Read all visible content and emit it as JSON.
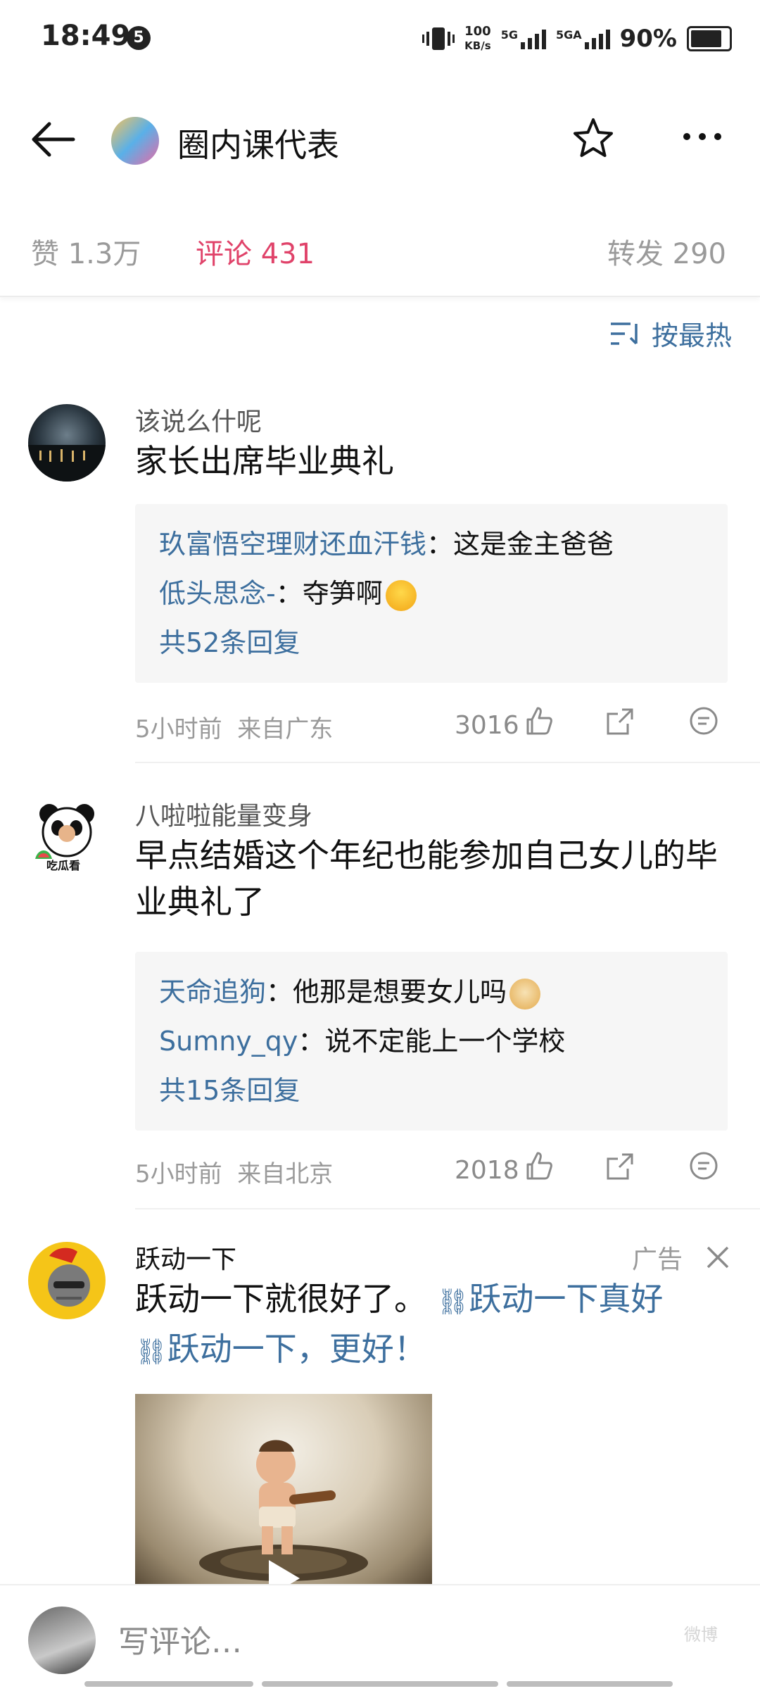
{
  "status_bar": {
    "time": "18:49",
    "notification_count": "5",
    "speed_top": "100",
    "speed_unit": "KB/s",
    "net1": "5G",
    "net2": "5GA",
    "battery": "90%",
    "battery_level": 0.9
  },
  "header": {
    "title": "圈内课代表",
    "icons": [
      "back-arrow-icon",
      "star-icon",
      "more-icon"
    ]
  },
  "tabs": [
    {
      "label": "赞 1.3万",
      "active": false
    },
    {
      "label": "评论 431",
      "active": true
    },
    {
      "label": "转发 290",
      "active": false
    }
  ],
  "sort": {
    "label": "按最热"
  },
  "comments": [
    {
      "user": "该说么什呢",
      "text": "家长出席毕业典礼",
      "replies": [
        {
          "name": "玖富悟空理财还血汗钱",
          "text": "：这是金主爸爸"
        },
        {
          "name": "低头思念-",
          "text": "：夺笋啊"
        }
      ],
      "total": "共52条回复",
      "time": "5小时前",
      "location": "来自广东",
      "likes": "3016"
    },
    {
      "user": "八啦啦能量变身",
      "avatar_text": "吃瓜看",
      "text": "早点结婚这个年纪也能参加自己女儿的毕业典礼了",
      "replies": [
        {
          "name": "天命追狗",
          "text": "：他那是想要女儿吗"
        },
        {
          "name": "Sumny_qy",
          "text": "：说不定能上一个学校"
        }
      ],
      "total": "共15条回复",
      "time": "5小时前",
      "location": "来自北京",
      "likes": "2018"
    }
  ],
  "ad": {
    "user": "跃动一下",
    "tag": "广告",
    "text": "跃动一下就很好了。",
    "link1": "跃动一下真好",
    "link2": "跃动一下，更好！"
  },
  "bottom": {
    "placeholder": "写评论…",
    "watermark": "微博"
  },
  "colors": {
    "accent": "#e0436a",
    "link": "#3d6f9e",
    "muted": "#9a9a9a"
  }
}
